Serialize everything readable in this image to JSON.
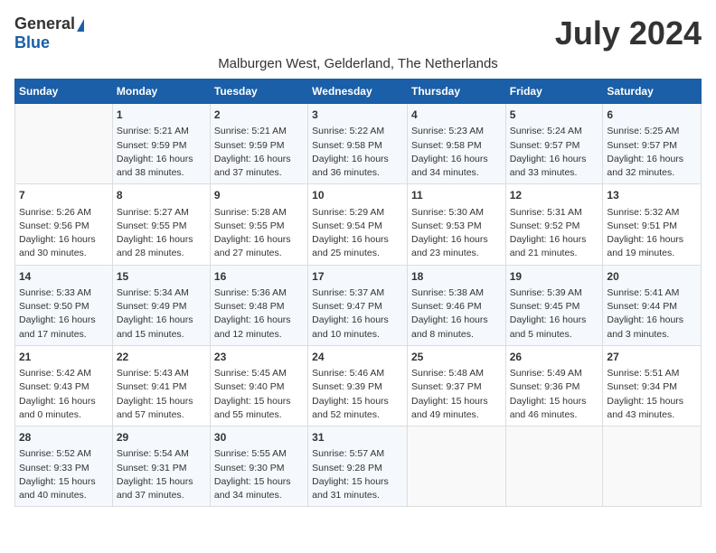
{
  "logo": {
    "general": "General",
    "blue": "Blue"
  },
  "title": "July 2024",
  "subtitle": "Malburgen West, Gelderland, The Netherlands",
  "days_of_week": [
    "Sunday",
    "Monday",
    "Tuesday",
    "Wednesday",
    "Thursday",
    "Friday",
    "Saturday"
  ],
  "weeks": [
    [
      {
        "day": "",
        "sunrise": "",
        "sunset": "",
        "daylight": ""
      },
      {
        "day": "1",
        "sunrise": "Sunrise: 5:21 AM",
        "sunset": "Sunset: 9:59 PM",
        "daylight": "Daylight: 16 hours and 38 minutes."
      },
      {
        "day": "2",
        "sunrise": "Sunrise: 5:21 AM",
        "sunset": "Sunset: 9:59 PM",
        "daylight": "Daylight: 16 hours and 37 minutes."
      },
      {
        "day": "3",
        "sunrise": "Sunrise: 5:22 AM",
        "sunset": "Sunset: 9:58 PM",
        "daylight": "Daylight: 16 hours and 36 minutes."
      },
      {
        "day": "4",
        "sunrise": "Sunrise: 5:23 AM",
        "sunset": "Sunset: 9:58 PM",
        "daylight": "Daylight: 16 hours and 34 minutes."
      },
      {
        "day": "5",
        "sunrise": "Sunrise: 5:24 AM",
        "sunset": "Sunset: 9:57 PM",
        "daylight": "Daylight: 16 hours and 33 minutes."
      },
      {
        "day": "6",
        "sunrise": "Sunrise: 5:25 AM",
        "sunset": "Sunset: 9:57 PM",
        "daylight": "Daylight: 16 hours and 32 minutes."
      }
    ],
    [
      {
        "day": "7",
        "sunrise": "Sunrise: 5:26 AM",
        "sunset": "Sunset: 9:56 PM",
        "daylight": "Daylight: 16 hours and 30 minutes."
      },
      {
        "day": "8",
        "sunrise": "Sunrise: 5:27 AM",
        "sunset": "Sunset: 9:55 PM",
        "daylight": "Daylight: 16 hours and 28 minutes."
      },
      {
        "day": "9",
        "sunrise": "Sunrise: 5:28 AM",
        "sunset": "Sunset: 9:55 PM",
        "daylight": "Daylight: 16 hours and 27 minutes."
      },
      {
        "day": "10",
        "sunrise": "Sunrise: 5:29 AM",
        "sunset": "Sunset: 9:54 PM",
        "daylight": "Daylight: 16 hours and 25 minutes."
      },
      {
        "day": "11",
        "sunrise": "Sunrise: 5:30 AM",
        "sunset": "Sunset: 9:53 PM",
        "daylight": "Daylight: 16 hours and 23 minutes."
      },
      {
        "day": "12",
        "sunrise": "Sunrise: 5:31 AM",
        "sunset": "Sunset: 9:52 PM",
        "daylight": "Daylight: 16 hours and 21 minutes."
      },
      {
        "day": "13",
        "sunrise": "Sunrise: 5:32 AM",
        "sunset": "Sunset: 9:51 PM",
        "daylight": "Daylight: 16 hours and 19 minutes."
      }
    ],
    [
      {
        "day": "14",
        "sunrise": "Sunrise: 5:33 AM",
        "sunset": "Sunset: 9:50 PM",
        "daylight": "Daylight: 16 hours and 17 minutes."
      },
      {
        "day": "15",
        "sunrise": "Sunrise: 5:34 AM",
        "sunset": "Sunset: 9:49 PM",
        "daylight": "Daylight: 16 hours and 15 minutes."
      },
      {
        "day": "16",
        "sunrise": "Sunrise: 5:36 AM",
        "sunset": "Sunset: 9:48 PM",
        "daylight": "Daylight: 16 hours and 12 minutes."
      },
      {
        "day": "17",
        "sunrise": "Sunrise: 5:37 AM",
        "sunset": "Sunset: 9:47 PM",
        "daylight": "Daylight: 16 hours and 10 minutes."
      },
      {
        "day": "18",
        "sunrise": "Sunrise: 5:38 AM",
        "sunset": "Sunset: 9:46 PM",
        "daylight": "Daylight: 16 hours and 8 minutes."
      },
      {
        "day": "19",
        "sunrise": "Sunrise: 5:39 AM",
        "sunset": "Sunset: 9:45 PM",
        "daylight": "Daylight: 16 hours and 5 minutes."
      },
      {
        "day": "20",
        "sunrise": "Sunrise: 5:41 AM",
        "sunset": "Sunset: 9:44 PM",
        "daylight": "Daylight: 16 hours and 3 minutes."
      }
    ],
    [
      {
        "day": "21",
        "sunrise": "Sunrise: 5:42 AM",
        "sunset": "Sunset: 9:43 PM",
        "daylight": "Daylight: 16 hours and 0 minutes."
      },
      {
        "day": "22",
        "sunrise": "Sunrise: 5:43 AM",
        "sunset": "Sunset: 9:41 PM",
        "daylight": "Daylight: 15 hours and 57 minutes."
      },
      {
        "day": "23",
        "sunrise": "Sunrise: 5:45 AM",
        "sunset": "Sunset: 9:40 PM",
        "daylight": "Daylight: 15 hours and 55 minutes."
      },
      {
        "day": "24",
        "sunrise": "Sunrise: 5:46 AM",
        "sunset": "Sunset: 9:39 PM",
        "daylight": "Daylight: 15 hours and 52 minutes."
      },
      {
        "day": "25",
        "sunrise": "Sunrise: 5:48 AM",
        "sunset": "Sunset: 9:37 PM",
        "daylight": "Daylight: 15 hours and 49 minutes."
      },
      {
        "day": "26",
        "sunrise": "Sunrise: 5:49 AM",
        "sunset": "Sunset: 9:36 PM",
        "daylight": "Daylight: 15 hours and 46 minutes."
      },
      {
        "day": "27",
        "sunrise": "Sunrise: 5:51 AM",
        "sunset": "Sunset: 9:34 PM",
        "daylight": "Daylight: 15 hours and 43 minutes."
      }
    ],
    [
      {
        "day": "28",
        "sunrise": "Sunrise: 5:52 AM",
        "sunset": "Sunset: 9:33 PM",
        "daylight": "Daylight: 15 hours and 40 minutes."
      },
      {
        "day": "29",
        "sunrise": "Sunrise: 5:54 AM",
        "sunset": "Sunset: 9:31 PM",
        "daylight": "Daylight: 15 hours and 37 minutes."
      },
      {
        "day": "30",
        "sunrise": "Sunrise: 5:55 AM",
        "sunset": "Sunset: 9:30 PM",
        "daylight": "Daylight: 15 hours and 34 minutes."
      },
      {
        "day": "31",
        "sunrise": "Sunrise: 5:57 AM",
        "sunset": "Sunset: 9:28 PM",
        "daylight": "Daylight: 15 hours and 31 minutes."
      },
      {
        "day": "",
        "sunrise": "",
        "sunset": "",
        "daylight": ""
      },
      {
        "day": "",
        "sunrise": "",
        "sunset": "",
        "daylight": ""
      },
      {
        "day": "",
        "sunrise": "",
        "sunset": "",
        "daylight": ""
      }
    ]
  ]
}
